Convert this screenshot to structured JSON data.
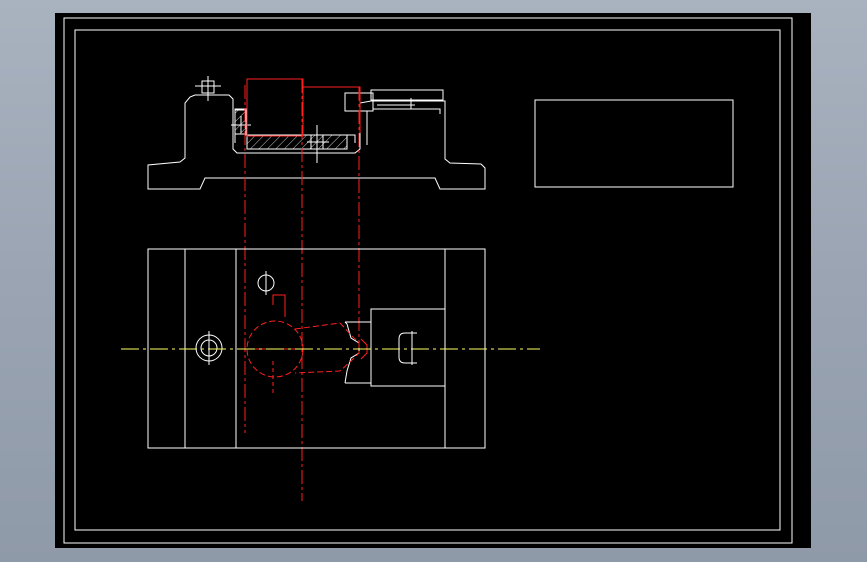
{
  "colors": {
    "background": "#000000",
    "geometry": "#ffffff",
    "hidden_part": "#ff2020",
    "centerline": "#ffff66",
    "hatch": "#ffffff",
    "window_frame": "#9aa4b2"
  },
  "drawing": {
    "views": [
      "front-view",
      "top-view"
    ],
    "title_block_text": ""
  }
}
